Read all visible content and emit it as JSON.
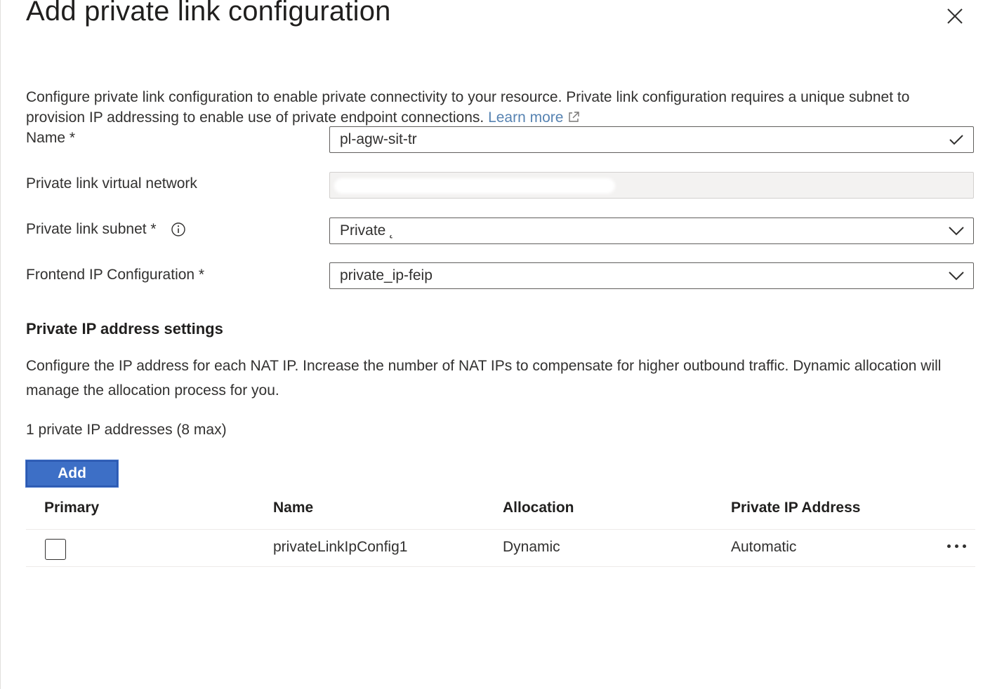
{
  "dialog": {
    "title": "Add private link configuration",
    "intro_text": "Configure private link configuration to enable private connectivity to your resource. Private link configuration requires a unique subnet to provision IP addressing to enable use of private endpoint connections.",
    "learn_more": "Learn more"
  },
  "form": {
    "name": {
      "label": "Name *",
      "value": "pl-agw-sit-tr"
    },
    "virtual_network": {
      "label": "Private link virtual network",
      "value": ""
    },
    "subnet": {
      "label": "Private link subnet *",
      "value": "Private  ̨"
    },
    "frontend_ip": {
      "label": "Frontend IP Configuration *",
      "value": "private_ip-feip"
    }
  },
  "ip_settings": {
    "heading": "Private IP address settings",
    "description": "Configure the IP address for each NAT IP. Increase the number of NAT IPs to compensate for higher outbound traffic. Dynamic allocation will manage the allocation process for you.",
    "count_text": "1 private IP addresses (8 max)",
    "add_label": "Add"
  },
  "table": {
    "columns": [
      "Primary",
      "Name",
      "Allocation",
      "Private IP Address"
    ],
    "rows": [
      {
        "primary": false,
        "name": "privateLinkIpConfig1",
        "allocation": "Dynamic",
        "private_ip": "Automatic"
      }
    ]
  },
  "icons": {
    "close": "close-icon",
    "external_link": "external-link-icon",
    "info": "info-icon",
    "checkmark": "checkmark-icon",
    "chevron": "chevron-down-icon",
    "more": "more-icon"
  }
}
